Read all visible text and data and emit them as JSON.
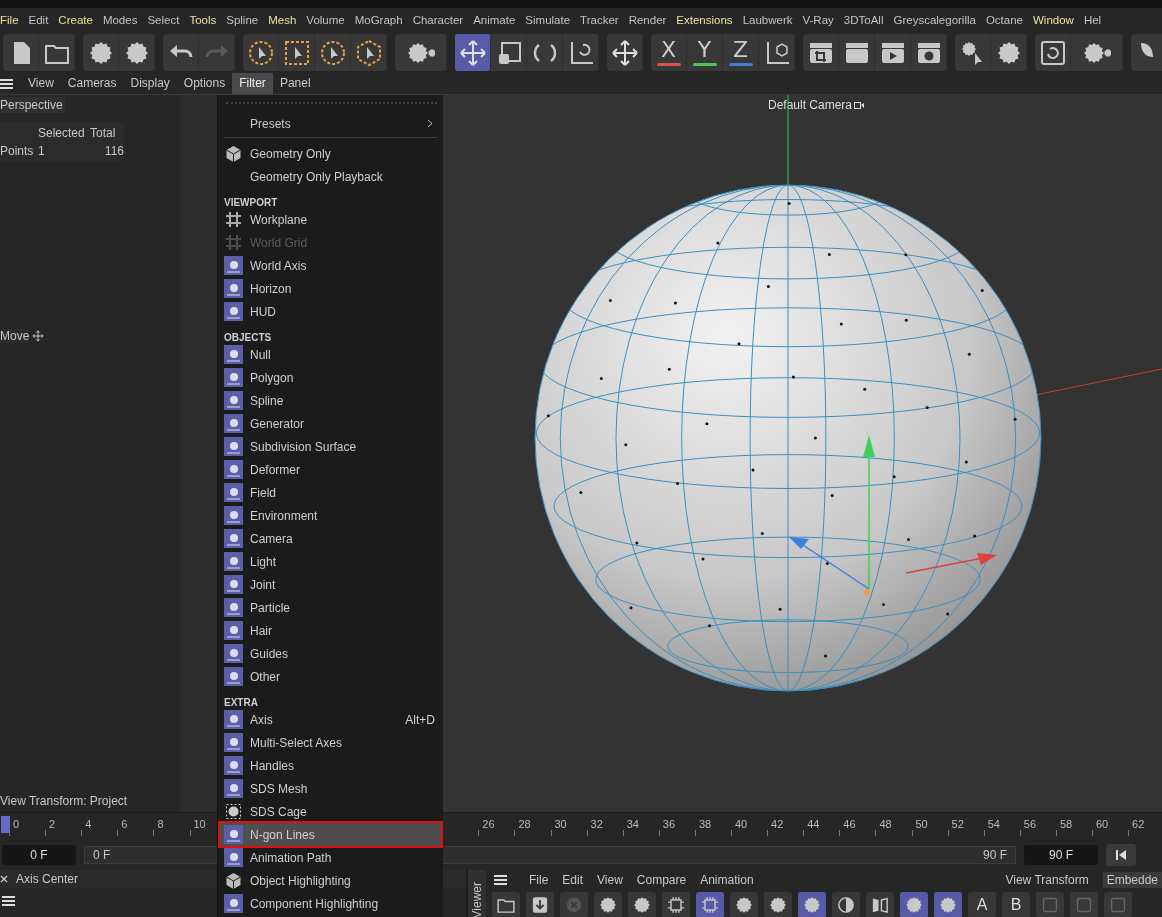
{
  "menu_bar": {
    "items": [
      {
        "label": "File",
        "highlighted": true
      },
      {
        "label": "Edit",
        "highlighted": false
      },
      {
        "label": "Create",
        "highlighted": true
      },
      {
        "label": "Modes",
        "highlighted": false
      },
      {
        "label": "Select",
        "highlighted": false
      },
      {
        "label": "Tools",
        "highlighted": true
      },
      {
        "label": "Spline",
        "highlighted": false
      },
      {
        "label": "Mesh",
        "highlighted": true
      },
      {
        "label": "Volume",
        "highlighted": false
      },
      {
        "label": "MoGraph",
        "highlighted": false
      },
      {
        "label": "Character",
        "highlighted": false
      },
      {
        "label": "Animate",
        "highlighted": false
      },
      {
        "label": "Simulate",
        "highlighted": false
      },
      {
        "label": "Tracker",
        "highlighted": false
      },
      {
        "label": "Render",
        "highlighted": false
      },
      {
        "label": "Extensions",
        "highlighted": true
      },
      {
        "label": "Laubwerk",
        "highlighted": false
      },
      {
        "label": "V-Ray",
        "highlighted": false
      },
      {
        "label": "3DToAll",
        "highlighted": false
      },
      {
        "label": "Greyscalegorilla",
        "highlighted": false
      },
      {
        "label": "Octane",
        "highlighted": false
      },
      {
        "label": "Window",
        "highlighted": true
      },
      {
        "label": "Hel",
        "highlighted": false
      }
    ]
  },
  "toolbar": {
    "groups": [
      [
        {
          "kind": "doc",
          "selected": false
        },
        {
          "kind": "folder",
          "selected": false
        }
      ],
      [
        {
          "kind": "gear",
          "selected": false
        },
        {
          "kind": "gear",
          "selected": false
        }
      ],
      [
        {
          "kind": "undo",
          "selected": false
        },
        {
          "kind": "redo",
          "selected": false
        }
      ],
      [
        {
          "kind": "sel-circle",
          "selected": false
        },
        {
          "kind": "sel-box",
          "selected": false
        },
        {
          "kind": "sel-circle",
          "selected": false
        },
        {
          "kind": "sel-poly",
          "selected": false
        }
      ],
      [
        {
          "kind": "gear-pair",
          "selected": false
        }
      ],
      [
        {
          "kind": "move",
          "selected": true
        },
        {
          "kind": "scale",
          "selected": false
        },
        {
          "kind": "rotate",
          "selected": false
        },
        {
          "kind": "axis",
          "selected": false
        }
      ],
      [
        {
          "kind": "move",
          "selected": false
        }
      ],
      [
        {
          "kind": "letter",
          "label": "X",
          "color": "#d9534f",
          "selected": false
        },
        {
          "kind": "letter",
          "label": "Y",
          "color": "#4cc35a",
          "selected": false
        },
        {
          "kind": "letter",
          "label": "Z",
          "color": "#3d7fd6",
          "selected": false
        },
        {
          "kind": "coord",
          "selected": false
        }
      ],
      [
        {
          "kind": "clapper-crop",
          "selected": false
        },
        {
          "kind": "clapper",
          "selected": false
        },
        {
          "kind": "clapper-play",
          "selected": false
        },
        {
          "kind": "clapper-gear",
          "selected": false
        }
      ],
      [
        {
          "kind": "gear-cursor",
          "selected": false
        },
        {
          "kind": "gear",
          "selected": false
        }
      ],
      [
        {
          "kind": "refresh",
          "selected": false
        },
        {
          "kind": "gear-pair",
          "selected": false
        }
      ],
      [
        {
          "kind": "leaf",
          "selected": false
        }
      ]
    ]
  },
  "viewport_menu": {
    "items": [
      {
        "label": "View",
        "selected": false
      },
      {
        "label": "Cameras",
        "selected": false
      },
      {
        "label": "Display",
        "selected": false
      },
      {
        "label": "Options",
        "selected": false
      },
      {
        "label": "Filter",
        "selected": true
      },
      {
        "label": "Panel",
        "selected": false
      }
    ]
  },
  "left_panel": {
    "view_name": "Perspective",
    "stats": {
      "columns": [
        "Selected",
        "Total"
      ],
      "row": {
        "label": "Points",
        "selected": "1",
        "total": "116"
      }
    },
    "tool": "Move",
    "view_transform": "View Transform: Project"
  },
  "viewport": {
    "camera": "Default Camera"
  },
  "filter_menu": {
    "items": [
      {
        "kind": "dotted"
      },
      {
        "kind": "submenu",
        "label": "Presets"
      },
      {
        "kind": "separator"
      },
      {
        "kind": "cube-item",
        "label": "Geometry Only",
        "disabled": false,
        "selected": false
      },
      {
        "kind": "plain-item",
        "label": "Geometry Only Playback",
        "disabled": false,
        "selected": false
      },
      {
        "kind": "header",
        "label": "VIEWPORT"
      },
      {
        "kind": "grid-item",
        "label": "Workplane",
        "disabled": false,
        "selected": false
      },
      {
        "kind": "grid-item",
        "label": "World Grid",
        "disabled": true,
        "selected": false
      },
      {
        "kind": "tile-item",
        "label": "World Axis",
        "disabled": false,
        "selected": false
      },
      {
        "kind": "tile-item",
        "label": "Horizon",
        "disabled": false,
        "selected": false
      },
      {
        "kind": "tile-item",
        "label": "HUD",
        "disabled": false,
        "selected": false
      },
      {
        "kind": "header",
        "label": "OBJECTS"
      },
      {
        "kind": "tile-item",
        "label": "Null",
        "disabled": false,
        "selected": false
      },
      {
        "kind": "tile-item",
        "label": "Polygon",
        "disabled": false,
        "selected": false
      },
      {
        "kind": "tile-item",
        "label": "Spline",
        "disabled": false,
        "selected": false
      },
      {
        "kind": "tile-item",
        "label": "Generator",
        "disabled": false,
        "selected": false
      },
      {
        "kind": "tile-item",
        "label": "Subdivision Surface",
        "disabled": false,
        "selected": false
      },
      {
        "kind": "tile-item",
        "label": "Deformer",
        "disabled": false,
        "selected": false
      },
      {
        "kind": "tile-item",
        "label": "Field",
        "disabled": false,
        "selected": false
      },
      {
        "kind": "tile-item",
        "label": "Environment",
        "disabled": false,
        "selected": false
      },
      {
        "kind": "tile-item",
        "label": "Camera",
        "disabled": false,
        "selected": false
      },
      {
        "kind": "tile-item",
        "label": "Light",
        "disabled": false,
        "selected": false
      },
      {
        "kind": "tile-item",
        "label": "Joint",
        "disabled": false,
        "selected": false
      },
      {
        "kind": "tile-item",
        "label": "Particle",
        "disabled": false,
        "selected": false
      },
      {
        "kind": "tile-item",
        "label": "Hair",
        "disabled": false,
        "selected": false
      },
      {
        "kind": "tile-item",
        "label": "Guides",
        "disabled": false,
        "selected": false
      },
      {
        "kind": "tile-item",
        "label": "Other",
        "disabled": false,
        "selected": false
      },
      {
        "kind": "header",
        "label": "EXTRA"
      },
      {
        "kind": "tile-item",
        "label": "Axis",
        "shortcut": "Alt+D",
        "disabled": false,
        "selected": false
      },
      {
        "kind": "tile-item",
        "label": "Multi-Select Axes",
        "disabled": false,
        "selected": false
      },
      {
        "kind": "tile-item",
        "label": "Handles",
        "disabled": false,
        "selected": false
      },
      {
        "kind": "tile-item",
        "label": "SDS Mesh",
        "disabled": false,
        "selected": false
      },
      {
        "kind": "cage-item",
        "label": "SDS Cage",
        "disabled": false,
        "selected": false
      },
      {
        "kind": "tile-item",
        "label": "N-gon Lines",
        "disabled": false,
        "selected": true
      },
      {
        "kind": "tile-item",
        "label": "Animation Path",
        "disabled": false,
        "selected": false
      },
      {
        "kind": "cube-item",
        "label": "Object Highlighting",
        "disabled": false,
        "selected": false
      },
      {
        "kind": "tile-item",
        "label": "Component Highlighting",
        "disabled": false,
        "selected": false
      }
    ]
  },
  "timeline": {
    "ticks": [
      "0",
      "2",
      "4",
      "6",
      "8",
      "10",
      "26",
      "28",
      "30",
      "32",
      "34",
      "36",
      "38",
      "40",
      "42",
      "44",
      "46",
      "48",
      "50",
      "52",
      "54",
      "56",
      "58",
      "60",
      "62"
    ],
    "current_field": "0 F",
    "range_start": "0 F",
    "range_end": "90 F",
    "end_field": "90 F"
  },
  "attribute_panel": {
    "title": "Axis Center"
  },
  "viewer_panel": {
    "tab": "Viewer",
    "menu": [
      "File",
      "Edit",
      "View",
      "Compare",
      "Animation"
    ],
    "view_transform_label": "View Transform",
    "view_transform_value": "Embedde",
    "tools": [
      {
        "kind": "folder",
        "selected": false
      },
      {
        "kind": "download",
        "selected": false
      },
      {
        "kind": "close",
        "selected": false
      },
      {
        "kind": "gear",
        "selected": false
      },
      {
        "kind": "gear",
        "selected": false
      },
      {
        "kind": "chip",
        "selected": false
      },
      {
        "kind": "chip",
        "selected": true
      },
      {
        "kind": "gear",
        "selected": false
      },
      {
        "kind": "gear",
        "selected": false
      },
      {
        "kind": "gear",
        "selected": true
      },
      {
        "kind": "half",
        "selected": false
      },
      {
        "kind": "compare",
        "selected": false
      },
      {
        "kind": "gear",
        "selected": true
      },
      {
        "kind": "gear",
        "selected": true
      },
      {
        "kind": "letter",
        "label": "A",
        "selected": false
      },
      {
        "kind": "letter",
        "label": "B",
        "selected": false
      },
      {
        "kind": "square",
        "selected": false
      },
      {
        "kind": "square",
        "selected": false
      },
      {
        "kind": "square",
        "selected": false
      }
    ]
  }
}
